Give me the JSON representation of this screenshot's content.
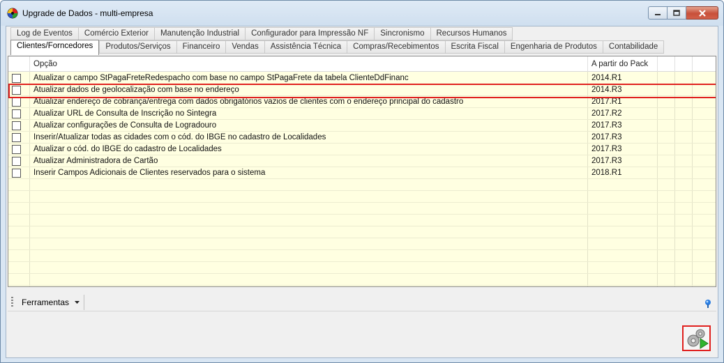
{
  "window": {
    "title": "Upgrade de Dados - multi-empresa",
    "minimize_icon": "minimize-icon",
    "maximize_icon": "maximize-icon",
    "close_icon": "close-icon"
  },
  "tabs_row1": [
    {
      "label": "Log de Eventos"
    },
    {
      "label": "Comércio Exterior"
    },
    {
      "label": "Manutenção Industrial"
    },
    {
      "label": "Configurador para Impressão NF"
    },
    {
      "label": "Sincronismo"
    },
    {
      "label": "Recursos Humanos"
    }
  ],
  "tabs_row2": [
    {
      "label": "Clientes/Forncedores",
      "active": true
    },
    {
      "label": "Produtos/Serviços"
    },
    {
      "label": "Financeiro"
    },
    {
      "label": "Vendas"
    },
    {
      "label": "Assistência Técnica"
    },
    {
      "label": "Compras/Recebimentos"
    },
    {
      "label": "Escrita Fiscal"
    },
    {
      "label": "Engenharia de Produtos"
    },
    {
      "label": "Contabilidade"
    }
  ],
  "grid": {
    "headers": {
      "option": "Opção",
      "pack": "A partir do Pack"
    },
    "rows": [
      {
        "option": "Atualizar o campo StPagaFreteRedespacho com base no campo StPagaFrete da tabela ClienteDdFinanc",
        "pack": "2014.R1",
        "checked": false
      },
      {
        "option": "Atualizar dados de geolocalização com base no endereço",
        "pack": "2014.R3",
        "checked": false,
        "highlighted": true
      },
      {
        "option": "Atualizar endereço de cobrança/entrega com dados obrigatórios vazios de clientes com o endereço principal do cadastro",
        "pack": "2017.R1",
        "checked": false
      },
      {
        "option": "Atualizar URL de Consulta de Inscrição no Sintegra",
        "pack": "2017.R2",
        "checked": false
      },
      {
        "option": "Atualizar configurações de Consulta de Logradouro",
        "pack": "2017.R3",
        "checked": false
      },
      {
        "option": "Inserir/Atualizar todas as cidades com o cód. do IBGE no cadastro de Localidades",
        "pack": "2017.R3",
        "checked": false
      },
      {
        "option": "Atualizar o cód. do IBGE do cadastro de Localidades",
        "pack": "2017.R3",
        "checked": false
      },
      {
        "option": "Atualizar Administradora de Cartão",
        "pack": "2017.R3",
        "checked": false
      },
      {
        "option": "Inserir Campos Adicionais de Clientes reservados para o sistema",
        "pack": "2018.R1",
        "checked": false
      }
    ]
  },
  "toolbar": {
    "tools_label": "Ferramentas",
    "tools_icon": "chevron-down-icon",
    "help_icon": "help-icon"
  },
  "actions": {
    "run_icon": "gears-run-icon"
  },
  "colors": {
    "grid_background": "#ffffe1",
    "highlight_border": "#e0201e",
    "window_frame": "#d9e6f3"
  }
}
